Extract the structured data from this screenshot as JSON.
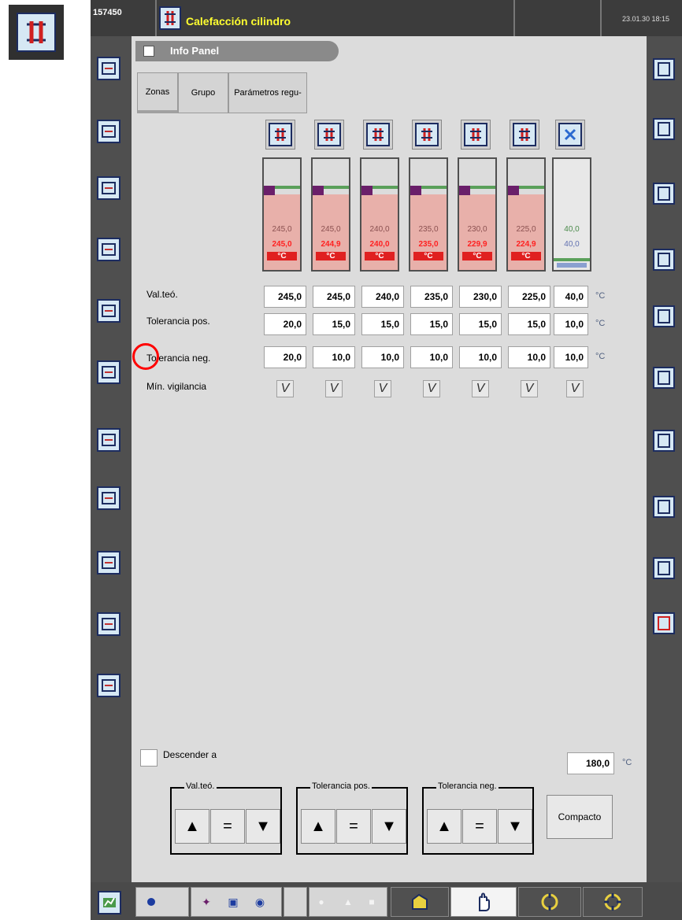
{
  "header": {
    "machine_id": "157450",
    "title": "Calefacción cilindro",
    "datetime": "23.01.30 18:15"
  },
  "info_panel": {
    "label": "Info Panel"
  },
  "tabs": [
    {
      "label": "Zonas",
      "active": true
    },
    {
      "label": "Grupo"
    },
    {
      "label": "Parámetros regu-"
    }
  ],
  "zones": [
    {
      "actual": "245,0",
      "current": "245,0",
      "unit": "°C"
    },
    {
      "actual": "245,0",
      "current": "244,9",
      "unit": "°C"
    },
    {
      "actual": "240,0",
      "current": "240,0",
      "unit": "°C"
    },
    {
      "actual": "235,0",
      "current": "235,0",
      "unit": "°C"
    },
    {
      "actual": "230,0",
      "current": "229,9",
      "unit": "°C"
    },
    {
      "actual": "225,0",
      "current": "224,9",
      "unit": "°C"
    },
    {
      "actual": "40,0",
      "current": "40,0",
      "unit": ""
    }
  ],
  "rows": {
    "setpoint": {
      "label": "Val.teó.",
      "values": [
        "245,0",
        "245,0",
        "240,0",
        "235,0",
        "230,0",
        "225,0",
        "40,0"
      ],
      "unit": "°C"
    },
    "tol_pos": {
      "label": "Tolerancia pos.",
      "values": [
        "20,0",
        "15,0",
        "15,0",
        "15,0",
        "15,0",
        "15,0",
        "10,0"
      ],
      "unit": "°C"
    },
    "tol_neg": {
      "label": "Tolerancia neg.",
      "values": [
        "20,0",
        "10,0",
        "10,0",
        "10,0",
        "10,0",
        "10,0",
        "10,0"
      ],
      "unit": "°C"
    },
    "monitoring": {
      "label": "Mín. vigilancia",
      "checked": [
        true,
        true,
        true,
        true,
        true,
        true,
        true
      ],
      "mark": "V"
    }
  },
  "lower": {
    "descend_label": "Descender a",
    "descend_value": "180,0",
    "descend_unit": "°C",
    "groups": [
      "Val.teó.",
      "Tolerancia pos.",
      "Tolerancia neg."
    ],
    "compact_label": "Compacto",
    "arrows": {
      "up": "▲",
      "eq": "=",
      "down": "▼"
    }
  },
  "colors": {
    "title": "#ffff30",
    "heater_fill": "#e8b0aa",
    "current_temp": "#ff2020",
    "setpoint_line": "#5aa05a",
    "annotation_circle": "#ff0000"
  },
  "icons": {
    "left_sidebar": [
      "screen-exchange-icon",
      "mold-in-icon",
      "mold-out-icon",
      "clamp-icon",
      "ejector-icon",
      "nozzle-icon",
      "injection-icon",
      "screw-icon",
      "hopper-icon",
      "heating-icon",
      "graph-icon"
    ],
    "right_sidebar": [
      "return-icon",
      "settings-icon",
      "copy-icon",
      "structure-icon",
      "operator-icon",
      "edit-icon",
      "edit-list-icon",
      "protocol-icon",
      "document-icon",
      "alarm-icon"
    ]
  }
}
